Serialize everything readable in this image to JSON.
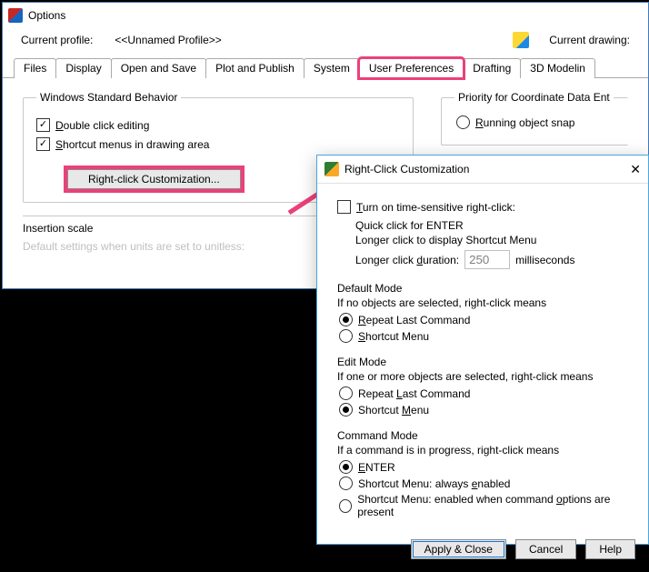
{
  "options": {
    "title": "Options",
    "profileLabel": "Current profile:",
    "profileValue": "<<Unnamed Profile>>",
    "currentDrawingLabel": "Current drawing:",
    "tabs": [
      "Files",
      "Display",
      "Open and Save",
      "Plot and Publish",
      "System",
      "User Preferences",
      "Drafting",
      "3D Modelin"
    ],
    "activeTab": "User Preferences",
    "wsb": {
      "legend": "Windows Standard Behavior",
      "doubleClick": {
        "label": "Double click editing",
        "checked": true,
        "ul": "D"
      },
      "shortcutMenus": {
        "label": "hortcut menus in drawing area",
        "prefix": "S",
        "checked": true
      },
      "rcButton": "Right-click Customization..."
    },
    "insertion": {
      "legend": "Insertion scale",
      "text": "Default settings when units are set to unitless:"
    },
    "priority": {
      "legend": "Priority for Coordinate Data Ent",
      "running": {
        "label": "unning object snap",
        "prefix": "R",
        "selected": false
      }
    }
  },
  "dialog": {
    "title": "Right-Click Customization",
    "timeSensitive": {
      "chkLabel": "urn on time-sensitive right-click:",
      "prefix": "T",
      "checked": false,
      "line1": "Quick click for ENTER",
      "line2": "Longer click to display Shortcut Menu",
      "durationLabel": "Longer click ",
      "durationUL": "d",
      "durationLabel2": "uration:",
      "durationValue": "250",
      "durationUnits": "milliseconds"
    },
    "defaultMode": {
      "title": "Default Mode",
      "desc": "If no objects are selected, right-click means",
      "opts": [
        {
          "label": "epeat Last Command",
          "prefix": "R",
          "selected": true
        },
        {
          "label": "hortcut Menu",
          "prefix": "S",
          "selected": false
        }
      ]
    },
    "editMode": {
      "title": "Edit Mode",
      "desc": "If one or more objects are selected, right-click means",
      "opts": [
        {
          "label": "Repeat ",
          "mid": "L",
          "suffix": "ast Command",
          "selected": false
        },
        {
          "label": "Shortcut ",
          "mid": "M",
          "suffix": "enu",
          "selected": true
        }
      ]
    },
    "commandMode": {
      "title": "Command Mode",
      "desc": "If a command is in progress, right-click means",
      "opts": [
        {
          "label": "NTER",
          "prefix": "E",
          "selected": true
        },
        {
          "label": "Shortcut Menu: always ",
          "mid": "e",
          "suffix": "nabled",
          "selected": false
        },
        {
          "label": "Shortcut Menu: enabled when command ",
          "mid": "o",
          "suffix": "ptions are present",
          "selected": false
        }
      ]
    },
    "buttons": {
      "apply": "Apply & Close",
      "cancel": "Cancel",
      "help": "Help"
    }
  }
}
